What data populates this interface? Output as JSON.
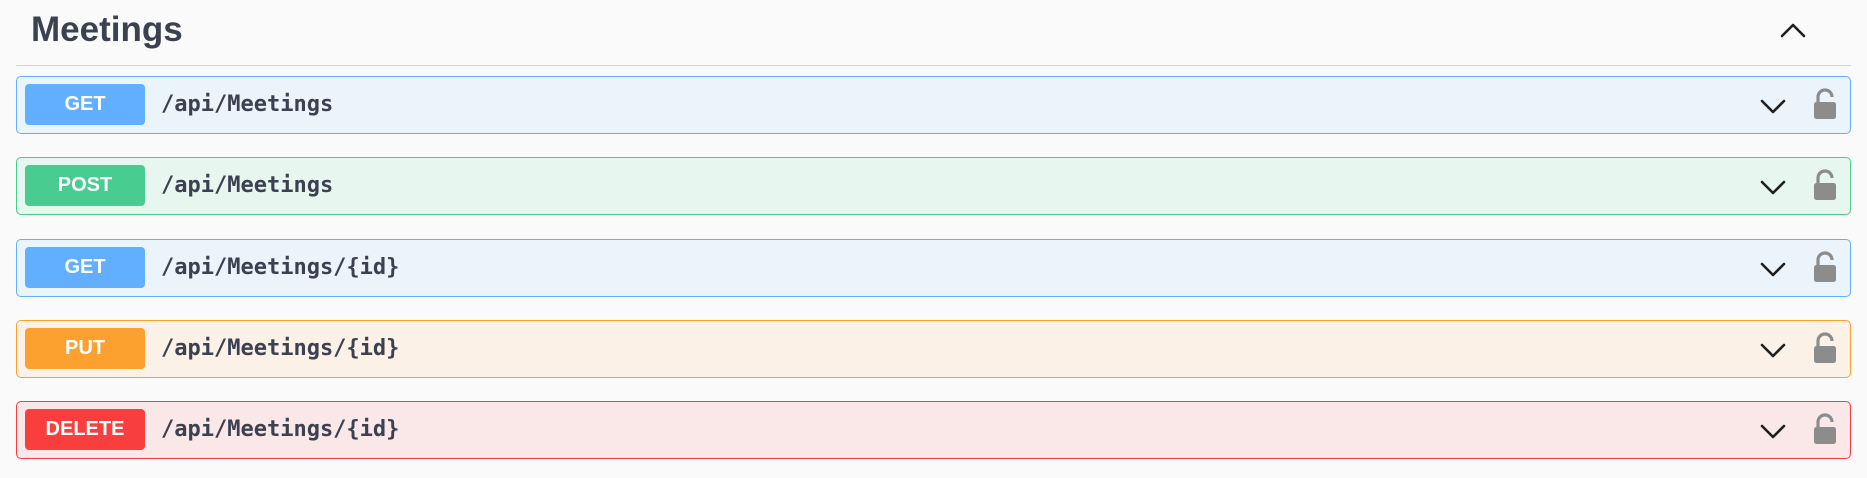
{
  "section": {
    "title": "Meetings",
    "collapse_icon": "chevron-up-icon"
  },
  "operations": [
    {
      "method": "GET",
      "path": "/api/Meetings",
      "color": "#61affe"
    },
    {
      "method": "POST",
      "path": "/api/Meetings",
      "color": "#49cc90"
    },
    {
      "method": "GET",
      "path": "/api/Meetings/{id}",
      "color": "#61affe"
    },
    {
      "method": "PUT",
      "path": "/api/Meetings/{id}",
      "color": "#fca130"
    },
    {
      "method": "DELETE",
      "path": "/api/Meetings/{id}",
      "color": "#f93e3e"
    }
  ],
  "icons": {
    "expand": "chevron-down-icon",
    "auth": "unlocked-lock-icon"
  },
  "colors": {
    "text": "#3b4151",
    "icon_gray": "#8c8c8c"
  }
}
